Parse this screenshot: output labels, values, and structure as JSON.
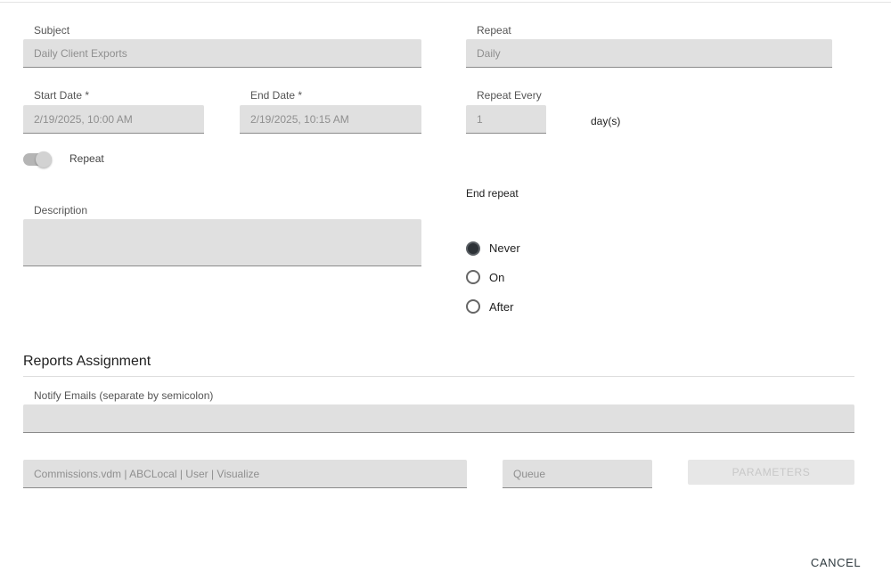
{
  "form": {
    "subject": {
      "label": "Subject",
      "value": "Daily Client Exports"
    },
    "repeat_select": {
      "label": "Repeat",
      "value": "Daily"
    },
    "start_date": {
      "label": "Start Date *",
      "value": "2/19/2025, 10:00 AM"
    },
    "end_date": {
      "label": "End Date *",
      "value": "2/19/2025, 10:15 AM"
    },
    "repeat_every": {
      "label": "Repeat Every",
      "value": "1",
      "unit": "day(s)"
    },
    "repeat_toggle": {
      "label": "Repeat",
      "on": true
    },
    "description": {
      "label": "Description",
      "value": ""
    },
    "end_repeat": {
      "label": "End repeat",
      "options": [
        {
          "label": "Never",
          "selected": true
        },
        {
          "label": "On",
          "selected": false
        },
        {
          "label": "After",
          "selected": false
        }
      ]
    }
  },
  "reports": {
    "title": "Reports Assignment",
    "notify_emails": {
      "label": "Notify Emails (separate by semicolon)",
      "value": ""
    },
    "report": {
      "value": "Commissions.vdm | ABCLocal | User | Visualize"
    },
    "queue": {
      "value": "Queue"
    },
    "parameters_label": "PARAMETERS"
  },
  "footer": {
    "cancel_label": "CANCEL"
  },
  "colors": {
    "field_bg": "#e0e0e0",
    "radio_selected": "#2d3237",
    "toggle_track": "#b5b5b5"
  }
}
